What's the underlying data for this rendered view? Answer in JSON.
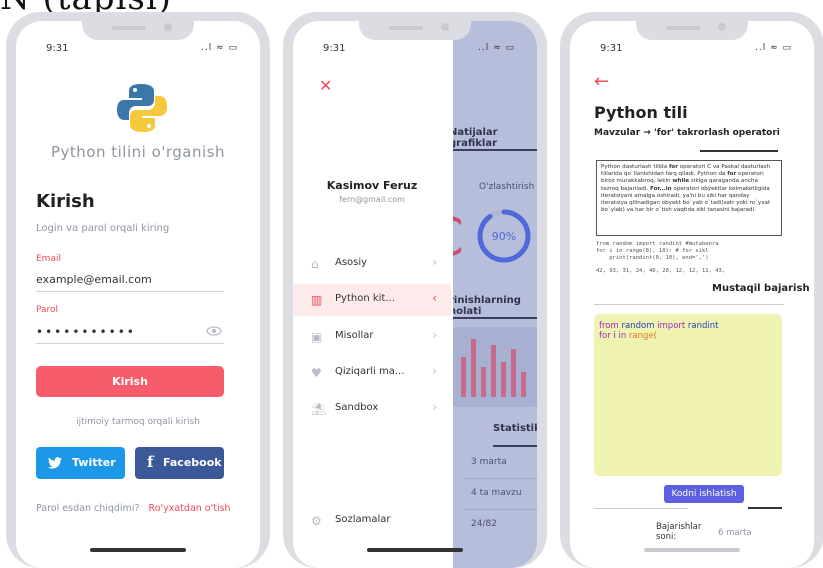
{
  "clip_title": "N (tapisi)",
  "colors": {
    "accent_red": "#f65c6c",
    "twitter": "#1d98e8",
    "facebook": "#3b5999",
    "indigo": "#5b5fe0",
    "editor_bg": "#f0f3b0",
    "overlay": "#b7bedb"
  },
  "status": {
    "time": "9:31",
    "icons": "∙∙∙∙ ≡ ▭"
  },
  "login": {
    "logo": "python-logo",
    "app_title": "Python tilini o'rganish",
    "heading": "Kirish",
    "subheading": "Login va parol orqali kiring",
    "email_label": "Email",
    "email_value": "example@email.com",
    "password_label": "Parol",
    "password_value": "•••••••••••",
    "submit": "Kirish",
    "social_hint": "ijtimoiy tarmoq orqali kirish",
    "twitter": "Twitter",
    "facebook": "Facebook",
    "forgot": "Parol esdan chiqdimi?",
    "register": "Ro'yxatdan o'tish"
  },
  "menu": {
    "user_name": "Kasimov Feruz",
    "user_email": "fern@gmail.com",
    "items": [
      {
        "label": "Asosiy",
        "icon": "home-icon"
      },
      {
        "label": "Python kit...",
        "icon": "book-icon"
      },
      {
        "label": "Misollar",
        "icon": "example-icon"
      },
      {
        "label": "Qiziqarli ma...",
        "icon": "heart-icon"
      },
      {
        "label": "Sandbox",
        "icon": "sandbox-icon"
      }
    ],
    "settings": "Sozlamalar",
    "bg": {
      "results_title": "Natijalar grafiklar",
      "mastery_label": "O'zlashtirish",
      "mastery_value": "90%",
      "mastery_fraction": 0.9,
      "students_title": "rinishlarning holati",
      "stats_title": "Statistika",
      "stats": [
        "3 marta",
        "4 ta mavzu",
        "24/82"
      ]
    }
  },
  "lesson": {
    "back": "←",
    "title": "Python tili",
    "crumb_topics": "Mavzular",
    "crumb_arrow": "→",
    "crumb_current": "'for' takrorlash operatori",
    "desc_p1": "Python dasturlash tilida ",
    "desc_for": "for",
    "desc_p2": " operatori C va Paskal dasturlash tillarida qo`llanishidan farq qiladi. Python da ",
    "desc_for2": "for",
    "desc_p3": " operatori biroz murakkabroq, lekin ",
    "desc_while": "while",
    "desc_p4": " siklga qaraganda ancha tezroq bajariladi. ",
    "desc_forin": "For...in",
    "desc_p5": " operatori obyektlar kelmaketligida iteratsiyani amalga oshiradi, ya'ni bu sikl har qanday iteratsiya qilinadigan obyekt bo`yab o`tadi(satr yoki ro`yxat bo`ylab) va har bir o`tish vaqtida sikl tanasini bajaradi.",
    "code_lines": [
      "from random import randint #mutabenra",
      "for i in range(8), 10):       # for sikl",
      "    print(randint(0, 10), end=',')"
    ],
    "output": "42, 93, 31, 24, 40, 20, 12, 12, 11, 43,",
    "tab_label": "Mustaqil bajarish",
    "editor_kw1": "from",
    "editor_t1": " random ",
    "editor_kw2": "import",
    "editor_t2": " randint",
    "editor_kw3": "for",
    "editor_t3": " i ",
    "editor_kw4": "in",
    "editor_t4": " range(",
    "run": "Kodni ishlatish",
    "runs_label": "Bajarishlar soni:",
    "runs_value": "6 marta"
  }
}
